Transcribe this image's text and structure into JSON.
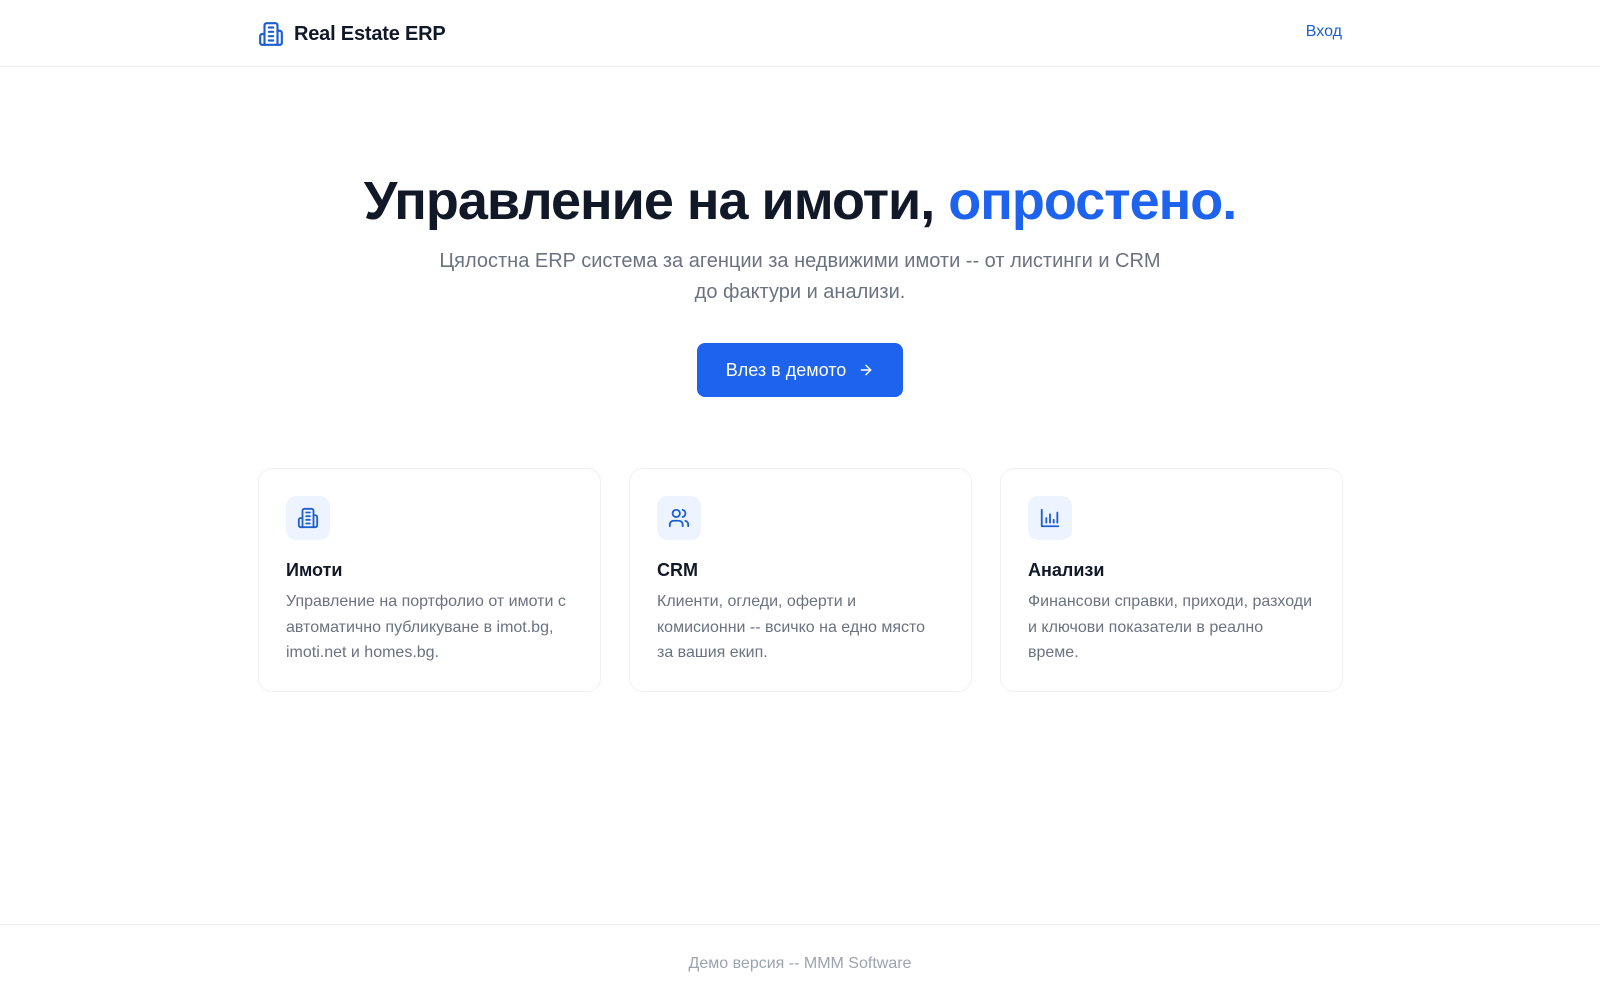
{
  "header": {
    "brand_name": "Real Estate ERP",
    "brand_icon": "building-icon",
    "login_label": "Вход"
  },
  "hero": {
    "title_main": "Управление на имоти, ",
    "title_accent": "опростено.",
    "subtitle": "Цялостна ERP система за агенции за недвижими имоти -- от листинги и CRM до фактури и анализи.",
    "cta_label": "Влез в демото",
    "cta_icon": "arrow-right-icon"
  },
  "features": [
    {
      "icon": "building-icon",
      "title": "Имоти",
      "text": "Управление на портфолио от имоти с автоматично публикуване в imot.bg, imoti.net и homes.bg."
    },
    {
      "icon": "users-icon",
      "title": "CRM",
      "text": "Клиенти, огледи, оферти и комисионни -- всичко на едно място за вашия екип."
    },
    {
      "icon": "bar-chart-icon",
      "title": "Анализи",
      "text": "Финансови справки, приходи, разходи и ключови показатели в реално време."
    }
  ],
  "footer": {
    "text": "Демо версия -- MMM Software"
  },
  "colors": {
    "accent": "#1d63ed",
    "link": "#1d5fd1",
    "icon_bg": "#eef4ff",
    "text_dark": "#111827",
    "text_muted": "#6b7280"
  }
}
